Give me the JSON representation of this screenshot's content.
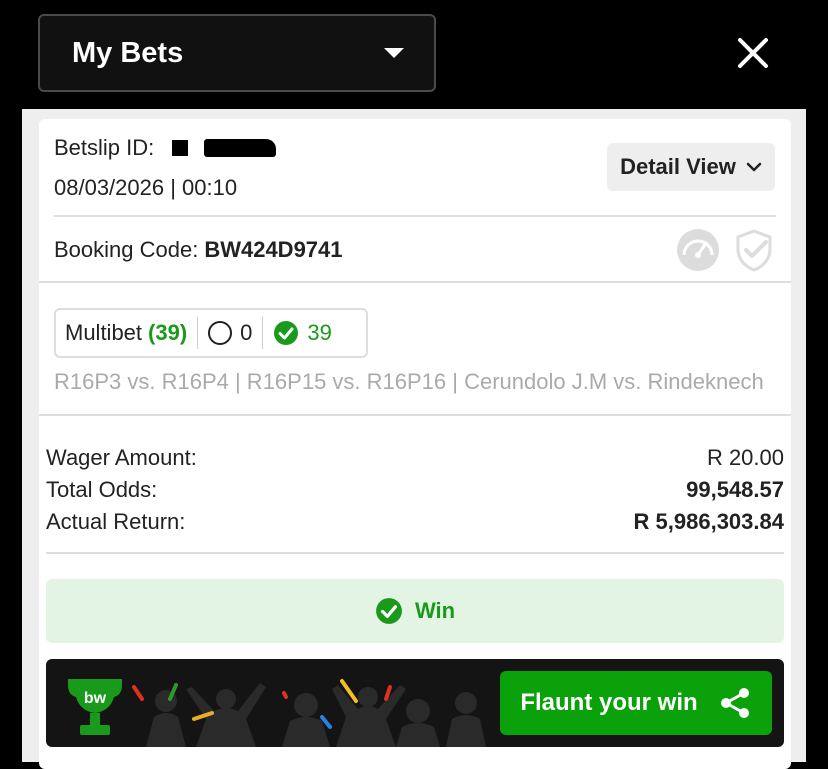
{
  "header": {
    "dropdown_label": "My Bets"
  },
  "bet": {
    "betslip_label": "Betslip ID:",
    "datetime": "08/03/2026 | 00:10",
    "detail_view_label": "Detail View",
    "booking_label": "Booking Code:",
    "booking_code": "BW424D9741",
    "multibet_label": "Multibet",
    "multibet_count": "(39)",
    "open_count": "0",
    "won_count": "39",
    "matches_summary": "R16P3 vs. R16P4 | R16P15 vs. R16P16 | Cerundolo J.M vs. Rindeknech",
    "wager_label": "Wager Amount:",
    "wager_value": "R 20.00",
    "odds_label": "Total Odds:",
    "odds_value": "99,548.57",
    "return_label": "Actual Return:",
    "return_value": "R 5,986,303.84",
    "status": "Win"
  },
  "promo": {
    "logo_text": "bw",
    "flaunt_label": "Flaunt your win"
  },
  "colors": {
    "accent_green": "#0aa10a",
    "win_bg": "#e4f4e4",
    "header_bg": "#000000"
  }
}
